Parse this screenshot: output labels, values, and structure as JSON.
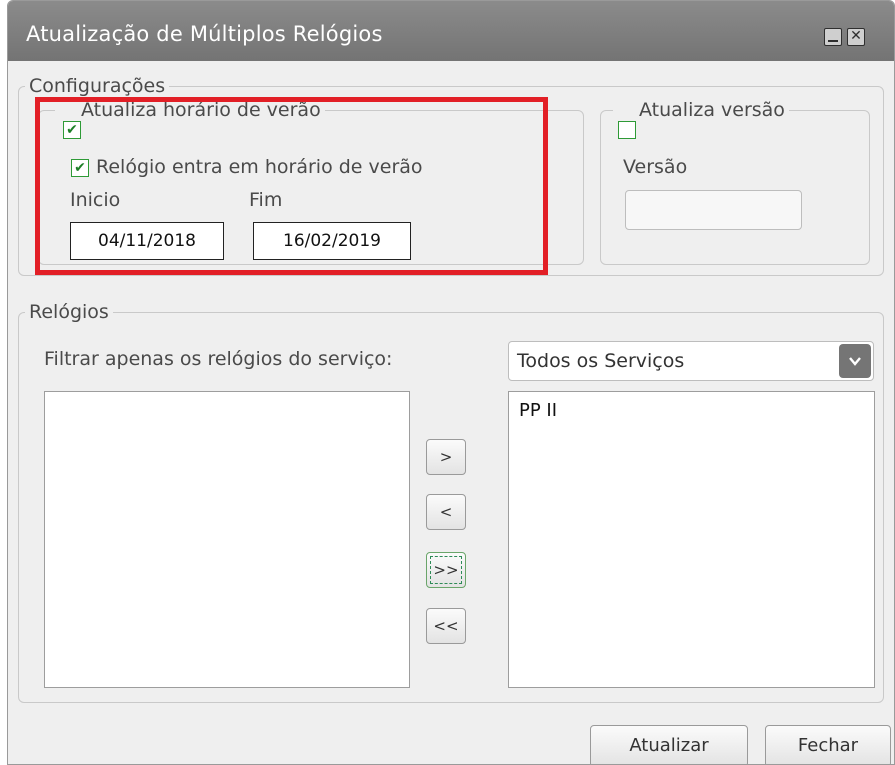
{
  "window": {
    "title": "Atualização de Múltiplos Relógios",
    "minimize_icon": "minimize-icon",
    "close_icon": "close-icon"
  },
  "config": {
    "legend": "Configurações",
    "dst": {
      "label": "Atualiza horário de verão",
      "checked": true,
      "enter_label": "Relógio entra em horário de verão",
      "enter_checked": true,
      "start_label": "Inicio",
      "end_label": "Fim",
      "start_value": "04/11/2018",
      "end_value": "16/02/2019"
    },
    "version": {
      "label": "Atualiza versão",
      "checked": false,
      "field_label": "Versão",
      "value": ""
    }
  },
  "clocks": {
    "legend": "Relógios",
    "filter_label": "Filtrar apenas os relógios do serviço:",
    "filter_value": "Todos os Serviços",
    "available": [],
    "selected": [
      "PP II"
    ],
    "buttons": {
      "add": ">",
      "remove": "<",
      "add_all": ">>",
      "remove_all": "<<"
    }
  },
  "footer": {
    "update": "Atualizar",
    "close": "Fechar"
  },
  "colors": {
    "titlebar": "#7a7a7a",
    "check": "#2e9a36",
    "highlight": "#e21f26"
  }
}
